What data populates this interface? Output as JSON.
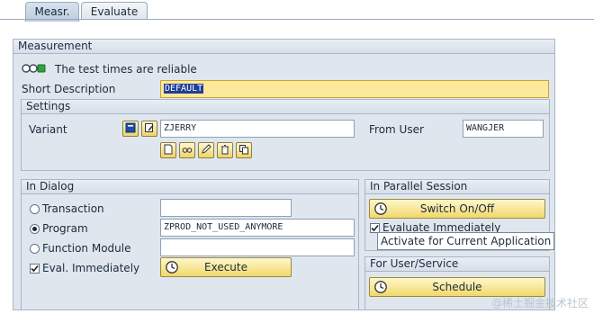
{
  "tabs": [
    "Measr.",
    "Evaluate"
  ],
  "measurement": {
    "title": "Measurement",
    "status_text": "The test times are reliable",
    "short_desc_label": "Short Description",
    "short_desc_value": "DEFAULT"
  },
  "settings": {
    "title": "Settings",
    "variant_label": "Variant",
    "variant_value": "ZJERRY",
    "from_user_label": "From User",
    "from_user_value": "WANGJER"
  },
  "in_dialog": {
    "title": "In Dialog",
    "transaction_label": "Transaction",
    "transaction_value": "",
    "program_label": "Program",
    "program_value": "ZPROD_NOT_USED_ANYMORE",
    "function_module_label": "Function Module",
    "function_module_value": "",
    "eval_immediately_label": "Eval. Immediately",
    "execute_label": "Execute",
    "selected_radio": "program"
  },
  "parallel": {
    "title": "In Parallel Session",
    "switch_label": "Switch On/Off",
    "evaluate_immediately_label": "Evaluate Immediately",
    "tooltip": "Activate for Current Application"
  },
  "service": {
    "title": "For User/Service",
    "schedule_label": "Schedule"
  },
  "watermark": "@稀土掘金技术社区",
  "colors": {
    "tab_active": "#c6d3e3",
    "panel_bg": "#dfe6ee",
    "highlight_field": "#fde99b",
    "button_bg": "#f1d86b",
    "selection": "#1f3f96",
    "status_green": "#2ea33a"
  }
}
